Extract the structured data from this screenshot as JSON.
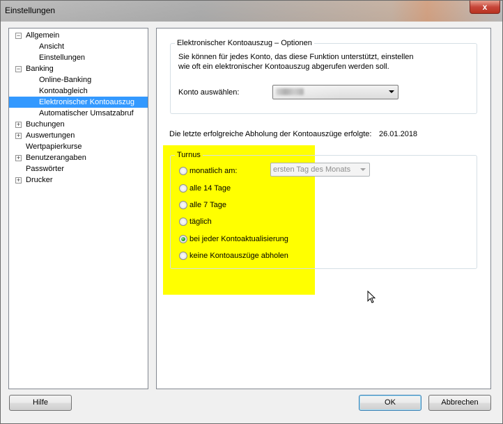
{
  "window": {
    "title": "Einstellungen",
    "close_label": "x"
  },
  "tree": {
    "items": [
      {
        "label": "Allgemein",
        "toggle": "−"
      },
      {
        "label": "Ansicht"
      },
      {
        "label": "Einstellungen"
      },
      {
        "label": "Banking",
        "toggle": "−"
      },
      {
        "label": "Online-Banking"
      },
      {
        "label": "Kontoabgleich"
      },
      {
        "label": "Elektronischer Kontoauszug"
      },
      {
        "label": "Automatischer Umsatzabruf"
      },
      {
        "label": "Buchungen",
        "toggle": "+"
      },
      {
        "label": "Auswertungen",
        "toggle": "+"
      },
      {
        "label": "Wertpapierkurse"
      },
      {
        "label": "Benutzerangaben",
        "toggle": "+"
      },
      {
        "label": "Passwörter"
      },
      {
        "label": "Drucker",
        "toggle": "+"
      }
    ]
  },
  "options": {
    "group_title": "Elektronischer Kontoauszug – Optionen",
    "description_line1": "Sie können für jedes Konto, das diese Funktion unterstützt, einstellen",
    "description_line2": "wie oft ein elektronischer Kontoauszug abgerufen werden soll.",
    "account_label": "Konto auswählen:"
  },
  "last_fetch": {
    "label": "Die letzte erfolgreiche Abholung der Kontoauszüge erfolgte:",
    "date": "26.01.2018"
  },
  "turnus": {
    "group_title": "Turnus",
    "monthly_label": "monatlich am:",
    "monthly_select_value": "ersten Tag des Monats",
    "options": [
      {
        "label": "alle 14 Tage",
        "checked": false
      },
      {
        "label": "alle 7 Tage",
        "checked": false
      },
      {
        "label": "täglich",
        "checked": false
      },
      {
        "label": "bei jeder Kontoaktualisierung",
        "checked": true
      },
      {
        "label": "keine Kontoauszüge abholen",
        "checked": false
      }
    ]
  },
  "buttons": {
    "help": "Hilfe",
    "ok": "OK",
    "cancel": "Abbrechen"
  },
  "colors": {
    "selection": "#3399ff",
    "highlight": "#ffff00"
  }
}
